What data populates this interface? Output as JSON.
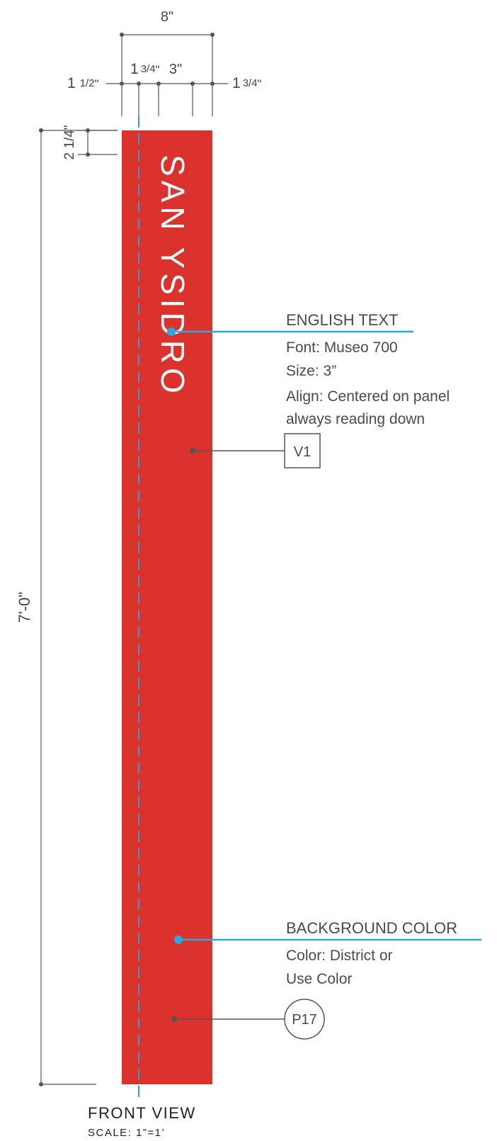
{
  "dimensions": {
    "overall_width": "8\"",
    "segment_a_whole": "1",
    "segment_a_fraction": "1/2",
    "segment_a_unit": "\"",
    "segment_b_whole": "1",
    "segment_b_fraction": "3/4",
    "segment_b_unit": "\"",
    "segment_c": "3\"",
    "segment_d_whole": "1",
    "segment_d_fraction": "3/4",
    "segment_d_unit": "\"",
    "top_margin": "2 1/4\"",
    "overall_height": "7'-0\""
  },
  "sign": {
    "text": "SAN YSIDRO",
    "color": "#dc322d",
    "text_color": "#ffffff"
  },
  "callouts": {
    "english_text": {
      "heading": "ENGLISH TEXT",
      "lines": [
        "Font: Museo 700",
        "Size: 3”",
        "Align: Centered on panel",
        "always reading down"
      ]
    },
    "v1_tag": "V1",
    "background_color": {
      "heading": "BACKGROUND COLOR",
      "lines": [
        "Color: District or",
        "Use Color"
      ]
    },
    "p17_tag": "P17"
  },
  "title_block": {
    "view": "FRONT VIEW",
    "scale": "SCALE: 1”=1’"
  },
  "colors": {
    "leader_blue": "#29a8e0",
    "centerline_blue": "#2a9fd8",
    "dim_gray": "#555555"
  }
}
